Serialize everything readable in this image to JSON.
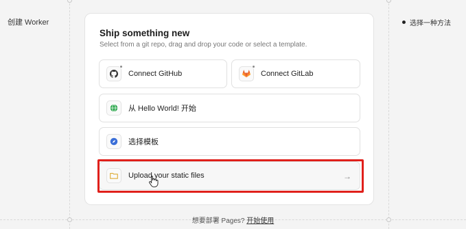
{
  "left": {
    "title": "创建 Worker"
  },
  "right": {
    "step": "选择一种方法"
  },
  "card": {
    "title": "Ship something new",
    "subtitle": "Select from a git repo, drag and drop your code or select a template."
  },
  "options": {
    "github": "Connect GitHub",
    "gitlab": "Connect GitLab",
    "hello": "从 Hello World! 开始",
    "template": "选择模板",
    "upload": "Upload your static files"
  },
  "footer": {
    "question": "想要部署 Pages?",
    "link": "开始使用"
  },
  "icons": {
    "github": "github-icon",
    "gitlab": "gitlab-icon",
    "hello": "globe-icon",
    "template": "compass-icon",
    "upload": "folder-icon",
    "arrow": "arrow-right-icon"
  },
  "colors": {
    "highlight": "#e0201b",
    "gitlab": "#e2632b",
    "globe": "#2ea84e",
    "compass": "#3b6fd8",
    "folder": "#d9a21b"
  }
}
